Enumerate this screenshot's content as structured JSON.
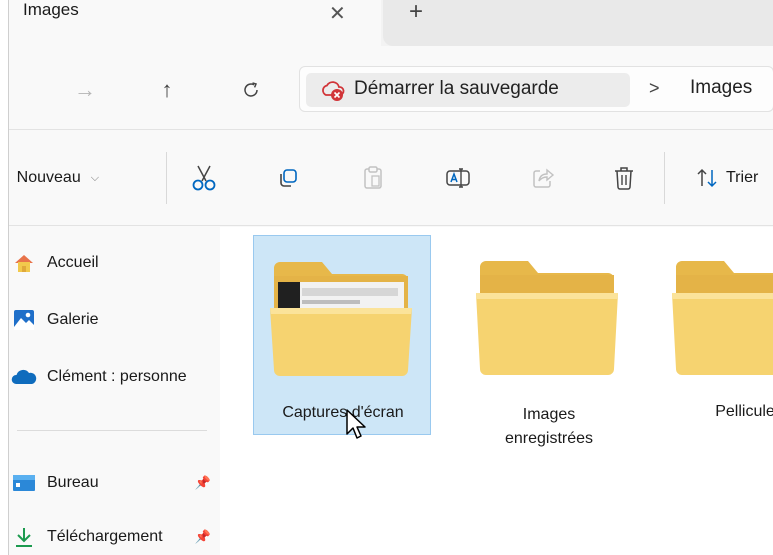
{
  "tab": {
    "title": "Images",
    "close_glyph": "✕",
    "new_tab_glyph": "+"
  },
  "nav": {
    "forward_glyph": "→",
    "up_glyph": "↑",
    "refresh_glyph": "C"
  },
  "address": {
    "backup_label": "Démarrer la sauvegarde",
    "separator": ">",
    "crumb": "Images"
  },
  "commands": {
    "new_label": "Nouveau",
    "new_glyph": ")",
    "sort_label": "Trier"
  },
  "sidebar": {
    "items": [
      {
        "label": "Accueil",
        "icon": "home-icon"
      },
      {
        "label": "Galerie",
        "icon": "gallery-icon"
      },
      {
        "label": "Clément : personne",
        "icon": "onedrive-cloud-icon"
      },
      {
        "label": "Bureau",
        "icon": "desktop-icon",
        "pinned": true
      },
      {
        "label": "Téléchargement",
        "icon": "download-icon",
        "pinned": true
      }
    ]
  },
  "folders": [
    {
      "name": "Captures d'écran",
      "selected": true
    },
    {
      "name_line1": "Images",
      "name_line2": "enregistrées",
      "selected": false
    },
    {
      "name": "Pellicule",
      "selected": false
    }
  ],
  "colors": {
    "accent": "#0067c0",
    "selection": "#cde6f7",
    "folder": "#f5d77a"
  }
}
